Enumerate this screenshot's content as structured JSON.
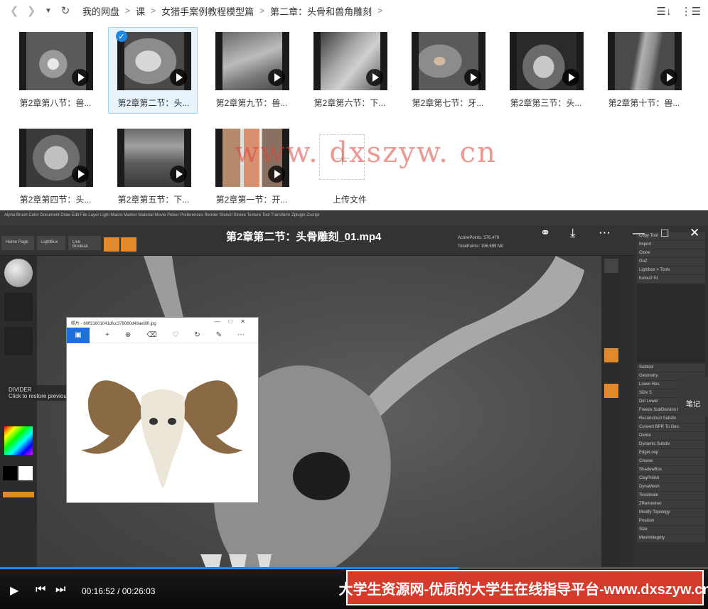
{
  "breadcrumb": [
    "我的网盘",
    "课",
    "女猎手案例教程模型篇",
    "第二章：头骨和兽角雕刻"
  ],
  "files": [
    {
      "label": "第2章第八节：兽...",
      "selected": false
    },
    {
      "label": "第2章第二节：头...",
      "selected": true
    },
    {
      "label": "第2章第九节：兽...",
      "selected": false
    },
    {
      "label": "第2章第六节：下...",
      "selected": false
    },
    {
      "label": "第2章第七节：牙...",
      "selected": false
    },
    {
      "label": "第2章第三节：头...",
      "selected": false
    },
    {
      "label": "第2章第十节：兽...",
      "selected": false
    },
    {
      "label": "第2章第四节：头...",
      "selected": false
    },
    {
      "label": "第2章第五节：下...",
      "selected": false
    },
    {
      "label": "第2章第一节：开...",
      "selected": false
    }
  ],
  "upload_label": "上传文件",
  "watermark": "www. dxszyw. cn",
  "player": {
    "title": "第2章第二节：头骨雕刻_01.mp4",
    "current_time": "00:16:52",
    "total_time": "00:26:03",
    "progress": 0.6476,
    "banner": "大学生资源网-优质的大学生在线指导平台-www.dxszyw.cn",
    "note_label": "笔记"
  },
  "zbrush": {
    "menu": "Alpha  Brush  Color  Document  Draw  Edit  File  Layer  Light  Macro  Marker  Material  Movie  Picker  Preferences  Render  Stencil  Stroke  Texture  Tool  Transform  Zplugin  Zscript",
    "home_page": "Home Page",
    "lightbox": "LightBox",
    "live_boolean": "Live Boolean",
    "divider_tip": "DIVIDER",
    "divider_sub": "Click to restore previous",
    "active_points": "ActivePoints: 576,479",
    "total_points": "TotalPoints: 196.699 Mil",
    "subtool_rows": [
      "Copy Tool",
      "Import",
      "Clone",
      "GoZ",
      "Lightbox > Tools",
      "Kulou2 51",
      "Subtool",
      "Geometry",
      "Lower Res",
      "SDiv 5",
      "Del Lower",
      "Freeze SubDivision Levels",
      "Reconstruct Subdiv",
      "Convert BPR To Geo",
      "Divide",
      "Dynamic Subdiv",
      "EdgeLoop",
      "Crease",
      "ShadowBox",
      "ClayPolish",
      "DynaMesh",
      "Tessimate",
      "ZRemesher",
      "Modify Topology",
      "Position",
      "Size",
      "MeshIntegrity"
    ]
  },
  "photo_viewer": {
    "title": "照片 - 60ff21601041dfcc378080d49ae89f.jpg"
  },
  "colors": {
    "accent": "#1e88e5",
    "banner": "#d43b2a",
    "watermark": "#dc463c"
  }
}
